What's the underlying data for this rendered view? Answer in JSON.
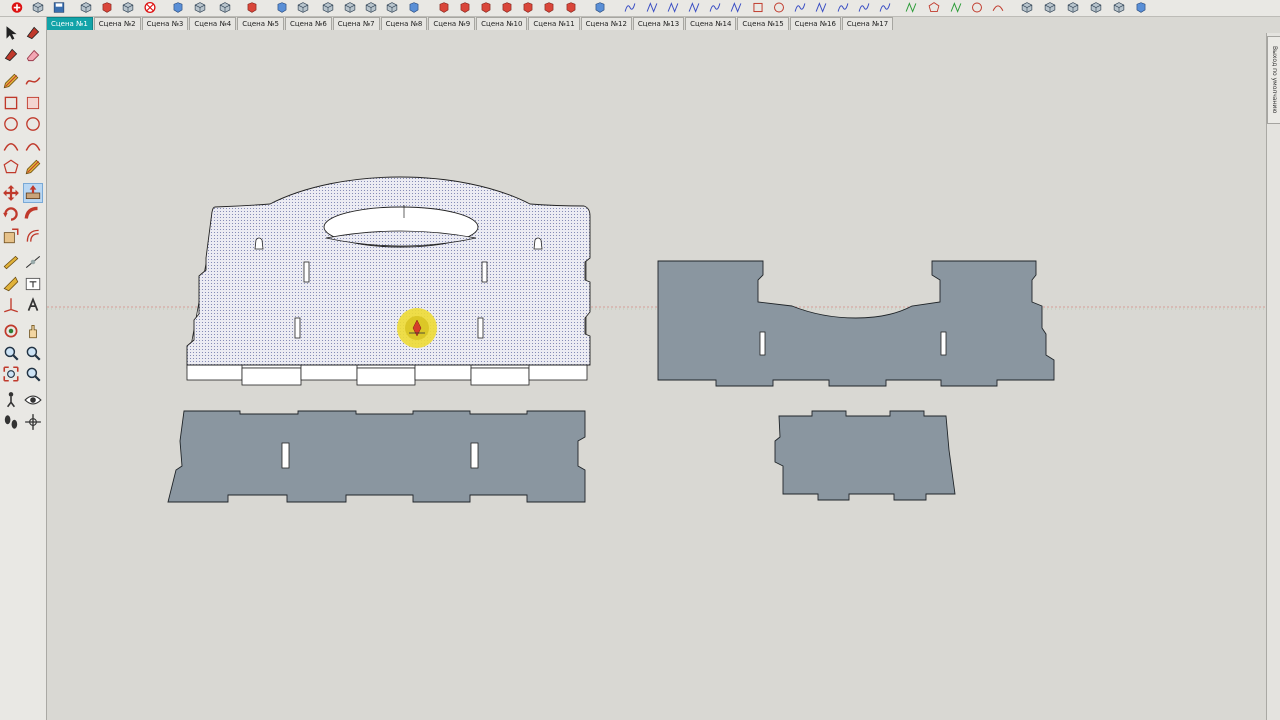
{
  "colors": {
    "active_tab": "#12a3a8",
    "part_gray": "#8a96a0",
    "selection_fill": "#ebebf3",
    "background": "#d9d8d3"
  },
  "scene_tabs": [
    {
      "label": "Сцена №1",
      "active": true
    },
    {
      "label": "Сцена №2"
    },
    {
      "label": "Сцена №3"
    },
    {
      "label": "Сцена №4"
    },
    {
      "label": "Сцена №5"
    },
    {
      "label": "Сцена №6"
    },
    {
      "label": "Сцена №7"
    },
    {
      "label": "Сцена №8"
    },
    {
      "label": "Сцена №9"
    },
    {
      "label": "Сцена №10"
    },
    {
      "label": "Сцена №11"
    },
    {
      "label": "Сцена №12"
    },
    {
      "label": "Сцена №13"
    },
    {
      "label": "Сцена №14"
    },
    {
      "label": "Сцена №15"
    },
    {
      "label": "Сцена №16"
    },
    {
      "label": "Сцена №17"
    }
  ],
  "right_panel": {
    "tab_label": "Выход по умолчанию"
  },
  "viewport": {
    "parts": [
      {
        "name": "side-panel-selected",
        "selected": true
      },
      {
        "name": "end-panel-with-cutout",
        "selected": false
      },
      {
        "name": "bottom-panel",
        "selected": false
      },
      {
        "name": "small-panel",
        "selected": false
      }
    ]
  }
}
